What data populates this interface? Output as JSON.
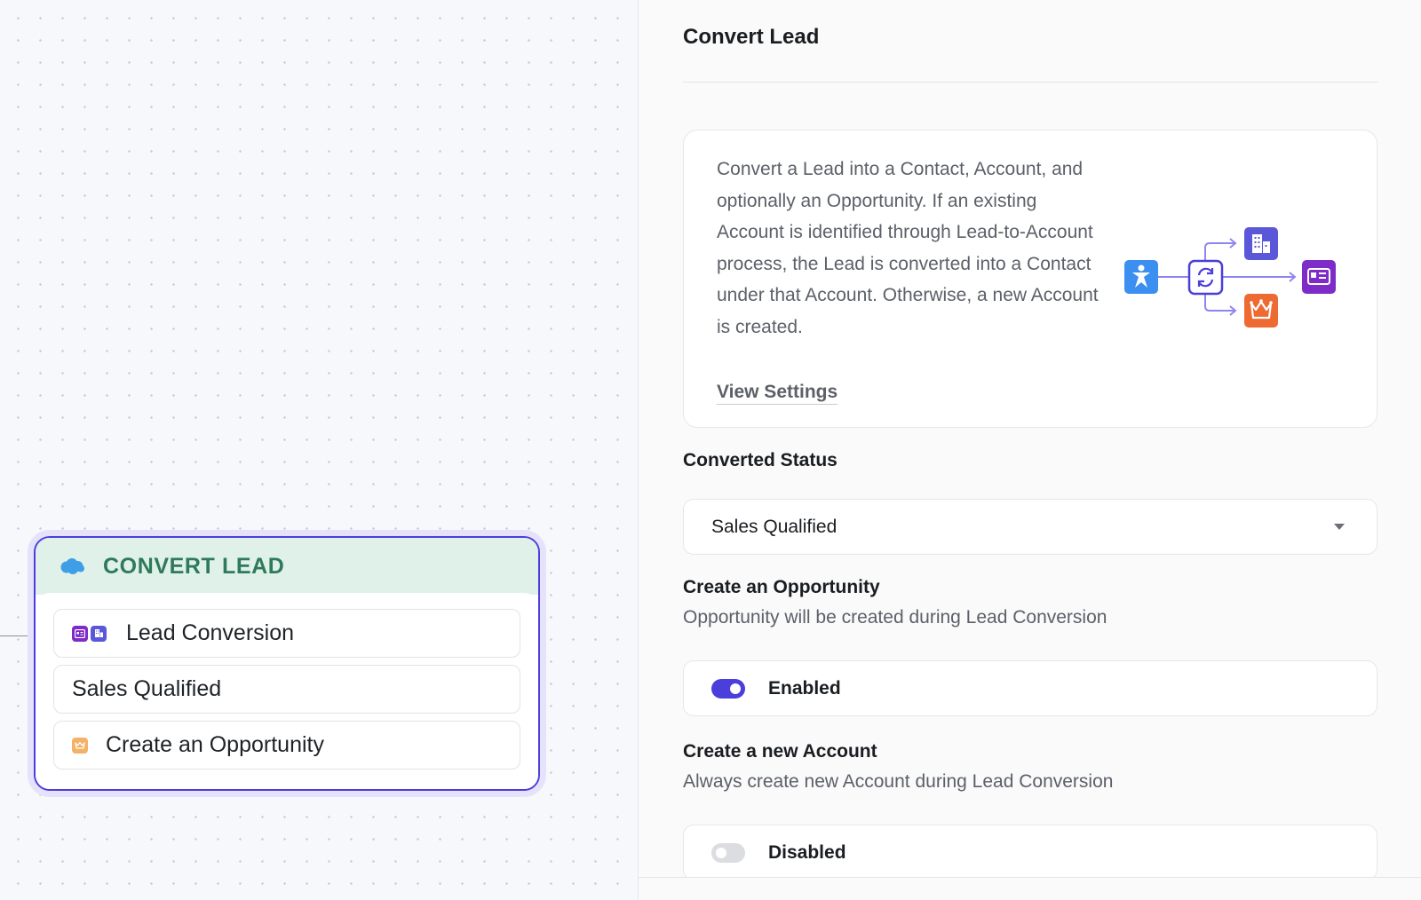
{
  "node": {
    "title": "CONVERT LEAD",
    "icon": "salesforce-cloud-icon",
    "rows": [
      {
        "label": "Lead Conversion",
        "icons": [
          "contact-card-icon",
          "building-icon"
        ]
      },
      {
        "label": "Sales Qualified"
      },
      {
        "label": "Create an Opportunity",
        "icons": [
          "crown-icon"
        ]
      }
    ]
  },
  "panel": {
    "title": "Convert Lead",
    "description": "Convert a Lead into a Contact, Account, and optionally an Opportunity. If an existing Account is identified through Lead-to-Account process, the Lead is converted into a Contact under that Account. Otherwise, a new Account is created.",
    "view_settings": "View Settings",
    "converted_status": {
      "label": "Converted Status",
      "value": "Sales Qualified"
    },
    "create_opportunity": {
      "label": "Create an Opportunity",
      "description": "Opportunity will be created during Lead Conversion",
      "state": "Enabled",
      "enabled": true
    },
    "create_account": {
      "label": "Create a new Account",
      "description": "Always create new Account during Lead Conversion",
      "state": "Disabled",
      "enabled": false
    }
  },
  "colors": {
    "accent": "#4b3fdc",
    "node_header_bg": "#dff1e8",
    "node_title": "#2e7a5b",
    "lead_blue": "#3b8ff0",
    "account_indigo": "#5b57d9",
    "opportunity_orange": "#ee6a33",
    "contact_purple": "#7e2cc8"
  }
}
